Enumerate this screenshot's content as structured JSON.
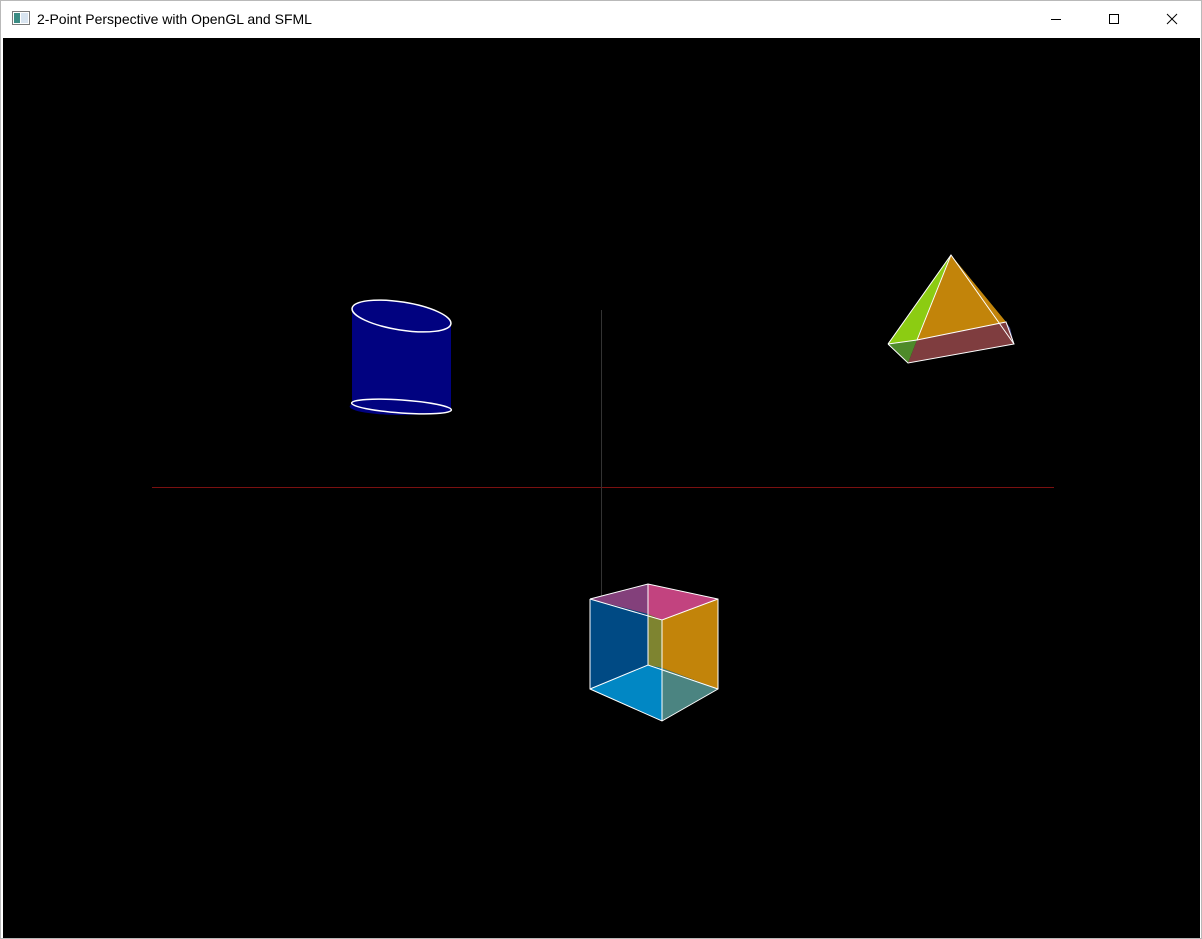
{
  "window": {
    "title": "2-Point Perspective with OpenGL and SFML",
    "app_icon": "window-app-icon",
    "controls": {
      "minimize_icon": "minimize-icon",
      "maximize_icon": "maximize-icon",
      "close_icon": "close-icon"
    }
  },
  "scene": {
    "background_color": "#000000",
    "horizon_line_color": "#7a1010",
    "vertical_axis_color": "#333333",
    "edge_color": "#ffffff",
    "objects": [
      {
        "name": "cylinder",
        "colors": {
          "body": "#010280",
          "top": "#010280"
        }
      },
      {
        "name": "pyramid",
        "colors": {
          "front_face": "#c2840a",
          "left_face": "#8ccc12",
          "right_face": "#7e8430",
          "base_front": "#7f3d3f",
          "base_left": "#4e8a2a",
          "base_right": "#4c4f90"
        }
      },
      {
        "name": "cube",
        "colors": {
          "top_left": "#83407b",
          "top_right": "#c2437f",
          "left_face": "#004a84",
          "right_face": "#c2840a",
          "bottom_left": "#0187c4",
          "bottom_right": "#4b8481",
          "back_strip": "#7e8430"
        }
      }
    ]
  }
}
